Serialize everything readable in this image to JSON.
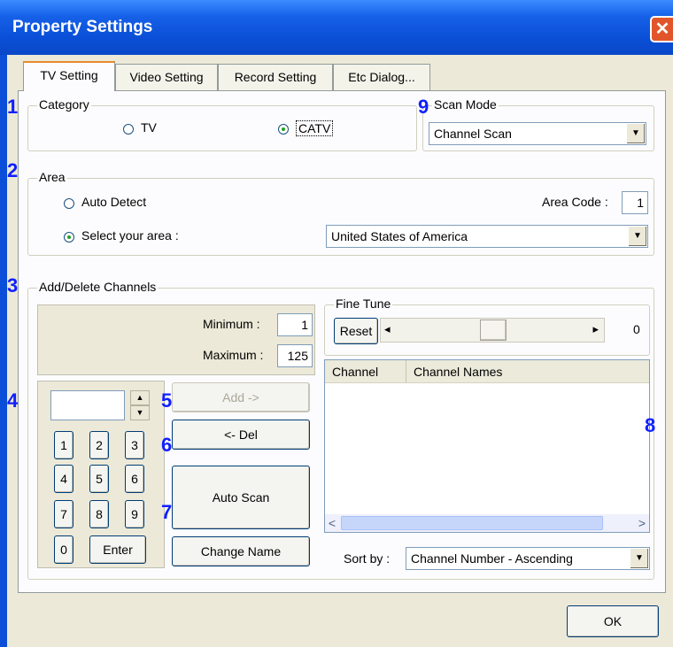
{
  "window": {
    "title": "Property Settings",
    "close_glyph": "✕"
  },
  "tabs": [
    {
      "label": "TV Setting"
    },
    {
      "label": "Video Setting"
    },
    {
      "label": "Record Setting"
    },
    {
      "label": "Etc Dialog..."
    }
  ],
  "callouts": [
    "1",
    "2",
    "3",
    "4",
    "5",
    "6",
    "7",
    "8",
    "9"
  ],
  "category": {
    "legend": "Category",
    "tv_label": "TV",
    "catv_label": "CATV",
    "selected": "CATV"
  },
  "scan_mode": {
    "legend": "Scan Mode",
    "value": "Channel Scan"
  },
  "area": {
    "legend": "Area",
    "auto_detect_label": "Auto Detect",
    "select_area_label": "Select your area :",
    "selected": "Select your area :",
    "area_code_label": "Area Code :",
    "area_code_value": "1",
    "area_value": "United States of America"
  },
  "channels": {
    "legend": "Add/Delete Channels",
    "minimum_label": "Minimum :",
    "minimum_value": "1",
    "maximum_label": "Maximum :",
    "maximum_value": "125",
    "keypad": [
      "1",
      "2",
      "3",
      "4",
      "5",
      "6",
      "7",
      "8",
      "9",
      "0",
      "Enter"
    ],
    "add_label": "Add ->",
    "del_label": "<- Del",
    "auto_scan_label": "Auto Scan",
    "change_name_label": "Change Name"
  },
  "fine_tune": {
    "legend": "Fine Tune",
    "reset_label": "Reset",
    "value": "0",
    "left_arrow": "◂",
    "right_arrow": "▸"
  },
  "channel_list": {
    "columns": [
      "Channel",
      "Channel Names"
    ],
    "rows": [],
    "scroll_left": "<",
    "scroll_right": ">"
  },
  "sort": {
    "label": "Sort by :",
    "value": "Channel Number - Ascending"
  },
  "ok_label": "OK",
  "icons": {
    "combo_arrow": "▼",
    "spin_up": "▲",
    "spin_down": "▼"
  }
}
